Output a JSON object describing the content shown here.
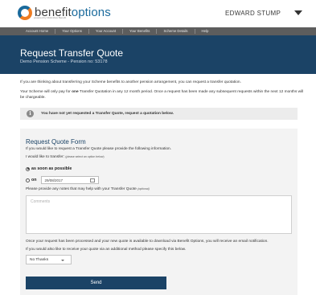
{
  "header": {
    "logo_main": "benefit",
    "logo_accent": "options",
    "logo_tagline": "powered by Distinctive Benefit",
    "user_name": "EDWARD STUMP"
  },
  "nav": {
    "items": [
      "Account Home",
      "Your Options",
      "Your Account",
      "Your Benefits",
      "Scheme Details",
      "Help"
    ]
  },
  "banner": {
    "title": "Request Transfer Quote",
    "subtitle": "Demo Pension Scheme - Pension no: 53178"
  },
  "intro": {
    "line1": "If you are thinking about transferring your Scheme benefits to another pension arrangement, you can request a transfer quotation.",
    "line2_a": "Your Scheme will only pay for ",
    "line2_bold": "one",
    "line2_b": " Transfer Quotation in any 12 month period. Once a request has been made any subsequent requests within the next 12 months will be chargeable."
  },
  "notice": {
    "icon": "info-icon",
    "text": "You have not yet requested a Transfer Quote, request a quotation below."
  },
  "form": {
    "title": "Request Quote Form",
    "intro": "If you would like to request a Transfer Quote please provide the following information.",
    "transfer_label": "I would like to transfer: ",
    "transfer_hint": "(please select an option below)",
    "option_asap": "as soon as possible",
    "option_on": "on",
    "date_value": "29/08/2017",
    "notes_label": "Please provide any notes that may help with your Transfer Quote ",
    "notes_hint": "(optional)",
    "comments_placeholder": "Comments",
    "after_text1": "Once your request has been processed and your new quote is available to download via Benefit Options, you will receive an email notification.",
    "after_text2": "If you would also like to receive your quote via an additional method please specify this below.",
    "method_value": "No Thanks",
    "send_label": "Send"
  },
  "colors": {
    "brand_blue": "#1b4366",
    "logo_blue": "#1a6a9c",
    "logo_orange": "#ef7d22",
    "nav_bg": "#5d5d5d"
  }
}
